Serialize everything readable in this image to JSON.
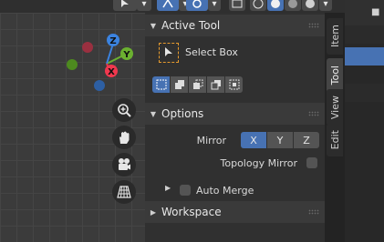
{
  "active_tool_panel": {
    "title": "Active Tool",
    "tool_name": "Select Box"
  },
  "options_panel": {
    "title": "Options",
    "mirror_label": "Mirror",
    "mirror_axes": [
      "X",
      "Y",
      "Z"
    ],
    "mirror_active_axis": "X",
    "topology_mirror_label": "Topology Mirror",
    "topology_mirror_checked": false,
    "auto_merge_label": "Auto Merge",
    "auto_merge_checked": false
  },
  "workspace_panel": {
    "title": "Workspace"
  },
  "sidebar_tabs": [
    "Item",
    "Tool",
    "View",
    "Edit"
  ],
  "sidebar_active_tab": "Tool",
  "gizmo": {
    "x_label": "X",
    "y_label": "Y",
    "z_label": "Z",
    "x_color": "#f0384e",
    "y_color": "#6bb030",
    "z_color": "#3b83e0"
  },
  "nav_buttons": [
    "zoom-icon",
    "hand-icon",
    "camera-icon",
    "grid-icon"
  ],
  "accent_color": "#4772b3",
  "outliner_checkbox_glyph": "■"
}
